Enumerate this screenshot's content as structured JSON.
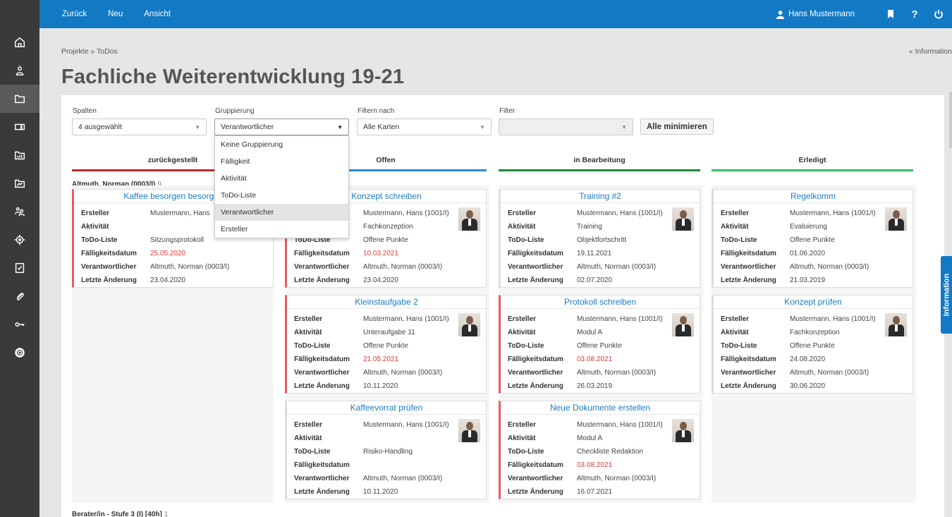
{
  "topbar": {
    "nav": [
      "Zurück",
      "Neu",
      "Ansicht"
    ],
    "user": "Hans Mustermann",
    "help": "?"
  },
  "breadcrumb": "Projekte » ToDos",
  "info_link": "« Information",
  "title": "Fachliche Weiterentwicklung 19-21",
  "controls": {
    "spalten_label": "Spalten",
    "spalten_value": "4 ausgewählt",
    "gruppierung_label": "Gruppierung",
    "gruppierung_value": "Verantwortlicher",
    "filtern_label": "Filtern nach",
    "filtern_value": "Alle Karten",
    "filter_label": "Filter",
    "filter_value": "",
    "minimize": "Alle minimieren"
  },
  "dropdown": [
    "Keine Gruppierung",
    "Fälligkeit",
    "Aktivität",
    "ToDo-Liste",
    "Verantwortlicher",
    "Ersteller"
  ],
  "columns": [
    {
      "label": "zurückgestellt",
      "color": "#c0282e"
    },
    {
      "label": "Offen",
      "color": "#2a8ad8"
    },
    {
      "label": "in Bearbeitung",
      "color": "#1f8a3a"
    },
    {
      "label": "Erledigt",
      "color": "#3cb86a"
    }
  ],
  "group1": {
    "name": "Altmuth, Norman (0003/I)",
    "count": "9"
  },
  "group2": {
    "name": "Berater/in - Stufe 3 (I) [40h]",
    "count": "1"
  },
  "keys": {
    "ersteller": "Ersteller",
    "aktivitaet": "Aktivität",
    "todo": "ToDo-Liste",
    "faellig": "Fälligkeitsdatum",
    "verantw": "Verantwortlicher",
    "aenderung": "Letzte Änderung"
  },
  "cards": [
    {
      "title": "Kaffee besorgen besorgen",
      "ersteller": "Mustermann, Hans",
      "aktivitaet": "",
      "todo": "Sitzungsprotokoll",
      "faellig": "25.05.2020",
      "verantw": "Altmuth, Norman (0003/I)",
      "aenderung": "23.04.2020"
    },
    {
      "title": "Konzept schreiben",
      "ersteller": "Mustermann, Hans (1001/I)",
      "aktivitaet": "Fachkonzeption",
      "todo": "Offene Punkte",
      "faellig": "10.03.2021",
      "verantw": "Altmuth, Norman (0003/I)",
      "aenderung": "23.04.2020"
    },
    {
      "title": "Kleinstaufgabe 2",
      "ersteller": "Mustermann, Hans (1001/I)",
      "aktivitaet": "Unteraufgabe 11",
      "todo": "Offene Punkte",
      "faellig": "21.05.2021",
      "verantw": "Altmuth, Norman (0003/I)",
      "aenderung": "10.11.2020"
    },
    {
      "title": "Kaffeevorrat prüfen",
      "ersteller": "Mustermann, Hans (1001/I)",
      "aktivitaet": "",
      "todo": "Risiko-Handling",
      "faellig": "",
      "verantw": "Altmuth, Norman (0003/I)",
      "aenderung": "10.11.2020"
    },
    {
      "title": "Training #2",
      "ersteller": "Mustermann, Hans (1001/I)",
      "aktivitaet": "Training",
      "todo": "Objektfortschritt",
      "faellig": "19.11.2021",
      "verantw": "Altmuth, Norman (0003/I)",
      "aenderung": "02.07.2020"
    },
    {
      "title": "Protokoll schreiben",
      "ersteller": "Mustermann, Hans (1001/I)",
      "aktivitaet": "Modul A",
      "todo": "Offene Punkte",
      "faellig": "03.08.2021",
      "verantw": "Altmuth, Norman (0003/I)",
      "aenderung": "26.03.2019"
    },
    {
      "title": "Neue Dokumente erstellen",
      "ersteller": "Mustermann, Hans (1001/I)",
      "aktivitaet": "Modul A",
      "todo": "Checkliste Redaktion",
      "faellig": "03.08.2021",
      "verantw": "Altmuth, Norman (0003/I)",
      "aenderung": "16.07.2021"
    },
    {
      "title": "Regelkomm",
      "ersteller": "Mustermann, Hans (1001/I)",
      "aktivitaet": "Evaluierung",
      "todo": "Offene Punkte",
      "faellig": "01.06.2020",
      "verantw": "Altmuth, Norman (0003/I)",
      "aenderung": "21.03.2019"
    },
    {
      "title": "Konzept prüfen",
      "ersteller": "Mustermann, Hans (1001/I)",
      "aktivitaet": "Fachkonzeption",
      "todo": "Offene Punkte",
      "faellig": "24.08.2020",
      "verantw": "Altmuth, Norman (0003/I)",
      "aenderung": "30.06.2020"
    }
  ],
  "info_tab": "Information"
}
